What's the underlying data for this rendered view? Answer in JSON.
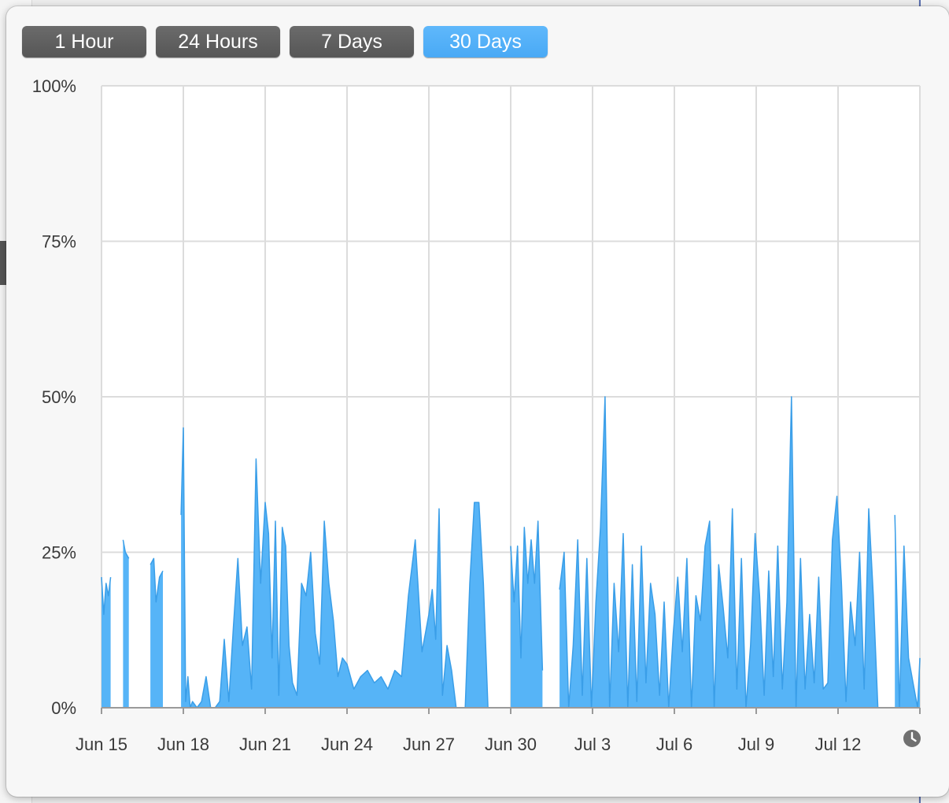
{
  "range_selector": {
    "buttons": [
      {
        "label": "1 Hour",
        "active": false
      },
      {
        "label": "24 Hours",
        "active": false
      },
      {
        "label": "7 Days",
        "active": false
      },
      {
        "label": "30 Days",
        "active": true
      }
    ]
  },
  "colors": {
    "series_fill": "#56b4f7",
    "series_line": "#3a9ee8",
    "grid": "#dcdcdc",
    "active_button": "#4faef7",
    "inactive_button": "#5f5f5f"
  },
  "icons": {
    "clock": "clock-icon"
  },
  "chart_data": {
    "type": "area",
    "title": "",
    "xlabel": "",
    "ylabel": "",
    "ylim": [
      0,
      100
    ],
    "y_unit": "%",
    "grid": true,
    "y_ticks": [
      "0%",
      "25%",
      "50%",
      "75%",
      "100%"
    ],
    "y_tick_values": [
      0,
      25,
      50,
      75,
      100
    ],
    "x_ticks": [
      "Jun 15",
      "Jun 18",
      "Jun 21",
      "Jun 24",
      "Jun 27",
      "Jun 30",
      "Jul 3",
      "Jul 6",
      "Jul 9",
      "Jul 12"
    ],
    "x_tick_values": [
      "06-15",
      "06-18",
      "06-21",
      "06-24",
      "06-27",
      "06-30",
      "07-03",
      "07-06",
      "07-09",
      "07-12"
    ],
    "xlim": [
      "06-15",
      "07-15"
    ],
    "series": [
      {
        "name": "",
        "segments": [
          {
            "x": [
              "06-15 00:00",
              "06-15 02:00",
              "06-15 04:00",
              "06-15 06:00",
              "06-15 08:00"
            ],
            "y": [
              21,
              15,
              20,
              18,
              21
            ]
          },
          {
            "x": [
              "06-15 19:00",
              "06-15 21:00",
              "06-16 00:00"
            ],
            "y": [
              27,
              25,
              24
            ]
          },
          {
            "x": [
              "06-16 19:00",
              "06-16 22:00",
              "06-17 00:00",
              "06-17 03:00",
              "06-17 06:00"
            ],
            "y": [
              23,
              24,
              17,
              21,
              22
            ]
          },
          {
            "x": [
              "06-17 22:00",
              "06-18 00:00",
              "06-18 02:00",
              "06-18 04:00",
              "06-18 06:00",
              "06-18 08:00",
              "06-18 12:00",
              "06-18 16:00",
              "06-18 20:00",
              "06-19 00:00",
              "06-19 04:00",
              "06-19 08:00",
              "06-19 12:00",
              "06-19 16:00",
              "06-19 20:00",
              "06-20 00:00",
              "06-20 04:00",
              "06-20 08:00",
              "06-20 12:00",
              "06-20 16:00",
              "06-20 20:00",
              "06-21 00:00",
              "06-21 03:00",
              "06-21 06:00",
              "06-21 09:00",
              "06-21 12:00",
              "06-21 15:00",
              "06-21 18:00",
              "06-21 21:00",
              "06-22 00:00",
              "06-22 04:00",
              "06-22 08:00",
              "06-22 12:00",
              "06-22 16:00",
              "06-22 20:00",
              "06-23 00:00",
              "06-23 04:00",
              "06-23 08:00",
              "06-23 12:00",
              "06-23 16:00",
              "06-23 20:00",
              "06-24 00:00",
              "06-24 06:00",
              "06-24 12:00",
              "06-24 18:00",
              "06-25 00:00",
              "06-25 06:00",
              "06-25 12:00",
              "06-25 18:00",
              "06-26 00:00",
              "06-26 06:00",
              "06-26 12:00",
              "06-26 18:00",
              "06-27 00:00",
              "06-27 03:00",
              "06-27 06:00",
              "06-27 09:00",
              "06-27 12:00",
              "06-27 16:00",
              "06-27 20:00",
              "06-28 00:00",
              "06-28 04:00",
              "06-28 08:00",
              "06-28 12:00",
              "06-28 16:00",
              "06-28 20:00",
              "06-29 00:00",
              "06-29 04:00",
              "06-29 08:00",
              "06-29 12:00"
            ],
            "y": [
              31,
              45,
              1,
              5,
              0,
              1,
              0,
              1,
              5,
              0,
              0,
              1,
              11,
              1,
              13,
              24,
              10,
              13,
              3,
              40,
              20,
              33,
              28,
              8,
              30,
              2,
              29,
              26,
              10,
              4,
              2,
              20,
              18,
              25,
              12,
              7,
              30,
              20,
              14,
              5,
              8,
              7,
              3,
              5,
              6,
              4,
              5,
              3,
              6,
              5,
              18,
              27,
              9,
              15,
              19,
              11,
              32,
              2,
              10,
              6,
              0,
              0,
              0,
              20,
              33,
              33,
              20,
              0,
              0,
              0
            ]
          },
          {
            "x": [
              "06-30 00:00",
              "06-30 03:00",
              "06-30 06:00",
              "06-30 09:00",
              "06-30 12:00",
              "06-30 15:00",
              "06-30 18:00",
              "06-30 21:00",
              "07-01 00:00",
              "07-01 04:00"
            ],
            "y": [
              26,
              17,
              26,
              8,
              29,
              20,
              27,
              20,
              30,
              6
            ]
          },
          {
            "x": [
              "07-01 19:00",
              "07-01 23:00",
              "07-02 03:00",
              "07-02 07:00",
              "07-02 11:00",
              "07-02 15:00",
              "07-02 19:00",
              "07-02 23:00",
              "07-03 03:00",
              "07-03 07:00",
              "07-03 11:00",
              "07-03 15:00",
              "07-03 19:00",
              "07-03 23:00",
              "07-04 03:00",
              "07-04 07:00",
              "07-04 11:00",
              "07-04 15:00",
              "07-04 19:00",
              "07-04 23:00",
              "07-05 03:00",
              "07-05 07:00",
              "07-05 11:00",
              "07-05 15:00",
              "07-05 19:00",
              "07-05 23:00",
              "07-06 03:00",
              "07-06 07:00",
              "07-06 11:00",
              "07-06 15:00",
              "07-06 19:00",
              "07-06 23:00",
              "07-07 03:00",
              "07-07 07:00",
              "07-07 11:00",
              "07-07 15:00",
              "07-07 19:00",
              "07-07 23:00",
              "07-08 03:00",
              "07-08 07:00",
              "07-08 11:00",
              "07-08 15:00",
              "07-08 19:00",
              "07-08 23:00",
              "07-09 03:00",
              "07-09 07:00",
              "07-09 11:00",
              "07-09 15:00",
              "07-09 19:00",
              "07-09 23:00",
              "07-10 03:00",
              "07-10 07:00",
              "07-10 11:00",
              "07-10 15:00",
              "07-10 19:00",
              "07-10 23:00",
              "07-11 03:00",
              "07-11 07:00",
              "07-11 11:00",
              "07-11 15:00",
              "07-11 19:00",
              "07-11 23:00",
              "07-12 03:00",
              "07-12 07:00",
              "07-12 11:00",
              "07-12 15:00",
              "07-12 19:00",
              "07-12 23:00",
              "07-13 03:00",
              "07-13 07:00",
              "07-13 11:00"
            ],
            "y": [
              19,
              25,
              0,
              10,
              27,
              2,
              24,
              0,
              17,
              29,
              50,
              0,
              20,
              9,
              28,
              0,
              23,
              1,
              26,
              4,
              20,
              15,
              2,
              17,
              0,
              12,
              21,
              9,
              24,
              0,
              18,
              14,
              26,
              30,
              0,
              23,
              16,
              8,
              32,
              3,
              24,
              0,
              10,
              28,
              18,
              2,
              22,
              5,
              26,
              3,
              17,
              50,
              0,
              24,
              3,
              15,
              4,
              21,
              3,
              4,
              27,
              34,
              20,
              1,
              17,
              10,
              25,
              3,
              32,
              18,
              0
            ]
          },
          {
            "x": [
              "07-14 02:00",
              "07-14 06:00",
              "07-14 10:00",
              "07-14 14:00",
              "07-14 18:00",
              "07-14 22:00",
              "07-15 00:00"
            ],
            "y": [
              31,
              0,
              26,
              8,
              4,
              0,
              8
            ]
          }
        ]
      }
    ]
  }
}
